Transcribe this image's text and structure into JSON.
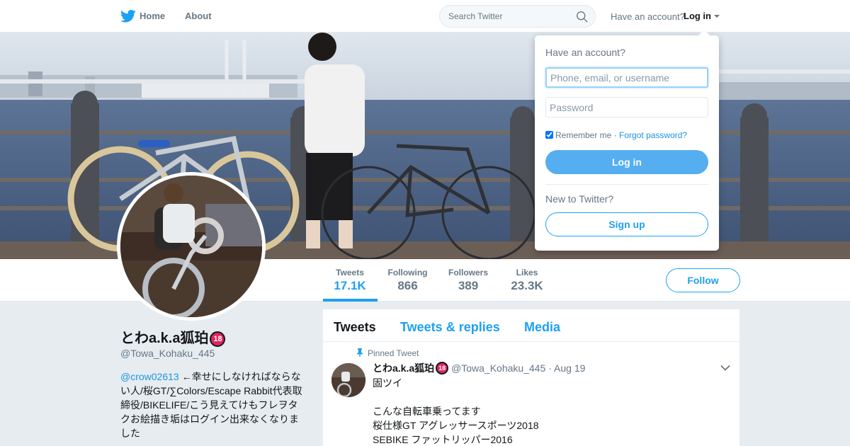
{
  "brand": {
    "accent": "#1da1f2",
    "logo_icon": "twitter-bird-icon"
  },
  "nav": {
    "home_label": "Home",
    "about_label": "About",
    "search_placeholder": "Search Twitter",
    "have_account": "Have an account?",
    "login_label": "Log in"
  },
  "profile": {
    "name": "とわa.k.a狐珀",
    "badge": "18",
    "handle": "@Towa_Kohaku_445",
    "bio_mention": "@crow02613",
    "bio_text": " ←幸せにしなければならない人/桜GT/∑Colors/Escape Rabbit代表取締役/BIKELIFE/こう見えてけもフレヲタクお絵描き垢はログイン出来なくなりました"
  },
  "stats": [
    {
      "label": "Tweets",
      "value": "17.1K",
      "active": true
    },
    {
      "label": "Following",
      "value": "866"
    },
    {
      "label": "Followers",
      "value": "389"
    },
    {
      "label": "Likes",
      "value": "23.3K"
    }
  ],
  "follow_label": "Follow",
  "timeline": {
    "tabs": [
      "Tweets",
      "Tweets & replies",
      "Media"
    ],
    "pinned_label": "Pinned Tweet",
    "tweet": {
      "name": "とわa.k.a狐珀",
      "badge": "18",
      "handle": "@Towa_Kohaku_445",
      "separator": "·",
      "date": "Aug 19",
      "lines": [
        "固ツイ",
        "",
        "こんな自転車乗ってます",
        "桜仕様GT アグレッサースポーツ2018",
        "SEBIKE ファットリッパー2016"
      ]
    }
  },
  "login_dropdown": {
    "title": "Have an account?",
    "username_placeholder": "Phone, email, or username",
    "password_placeholder": "Password",
    "remember_label": "Remember me",
    "separator": "·",
    "forgot_label": "Forgot password?",
    "login_button": "Log in",
    "new_label": "New to Twitter?",
    "signup_button": "Sign up"
  }
}
